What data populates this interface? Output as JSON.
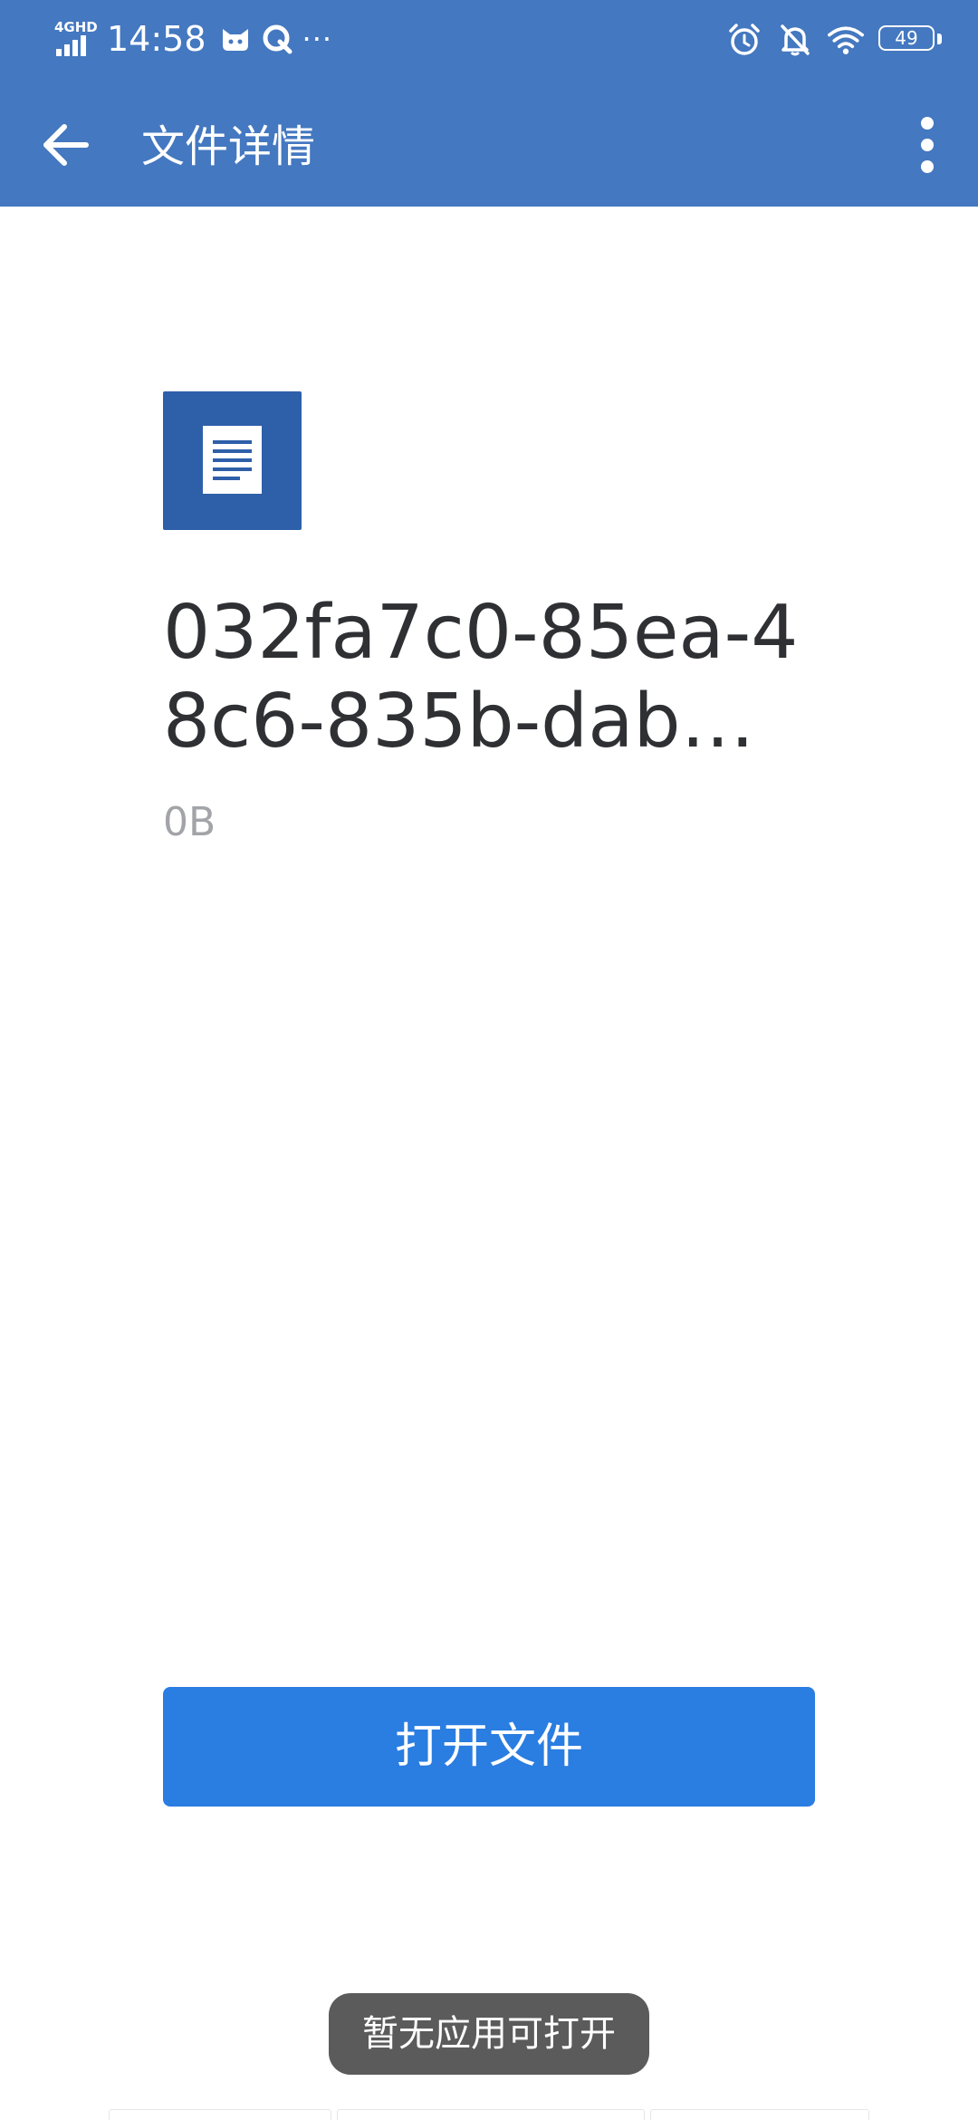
{
  "status_bar": {
    "network_label": "4GHD",
    "time": "14:58",
    "overflow_dots": "···",
    "battery_level": "49",
    "icons": [
      "cat-app-icon",
      "q-app-icon",
      "alarm-icon",
      "mute-bell-icon",
      "wifi-icon",
      "battery-icon"
    ]
  },
  "app_bar": {
    "title": "文件详情",
    "back_icon": "arrow-left-icon",
    "more_icon": "more-vertical-icon"
  },
  "file": {
    "icon": "document-icon",
    "name": "032fa7c0-85ea-48c6-835b-dab…",
    "size": "0B"
  },
  "actions": {
    "open_label": "打开文件"
  },
  "toast": {
    "message": "暂无应用可打开"
  },
  "colors": {
    "header": "#4478C0",
    "file_icon_bg": "#2E5FA9",
    "primary_button": "#2A7DE1",
    "toast_bg": "#5B5B5B",
    "file_name_text": "#2F3033",
    "file_size_text": "#A2A4A8"
  }
}
